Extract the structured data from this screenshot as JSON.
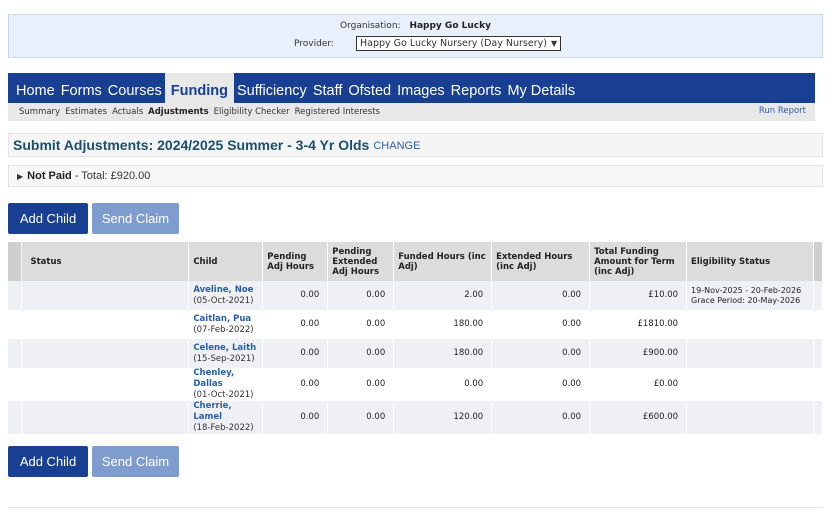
{
  "org": {
    "org_label": "Organisation:",
    "org_name": "Happy Go Lucky",
    "provider_label": "Provider:",
    "provider_value": "Happy Go Lucky Nursery (Day Nursery)"
  },
  "nav": {
    "items": [
      "Home",
      "Forms",
      "Courses",
      "Funding",
      "Sufficiency",
      "Staff",
      "Ofsted",
      "Images",
      "Reports",
      "My Details"
    ],
    "active": "Funding"
  },
  "subnav": {
    "items": [
      "Summary",
      "Estimates",
      "Actuals",
      "Adjustments",
      "Eligibility Checker",
      "Registered Interests"
    ],
    "active": "Adjustments",
    "run_report": "Run Report"
  },
  "page": {
    "title": "Submit Adjustments: 2024/2025 Summer - 3-4 Yr Olds",
    "change_link": "CHANGE",
    "not_paid_label": "Not Paid",
    "not_paid_total": "- Total: £920.00"
  },
  "buttons": {
    "add_child": "Add Child",
    "send_claim": "Send Claim"
  },
  "table": {
    "headers": {
      "status": "Status",
      "child": "Child",
      "pending_adj": "Pending Adj Hours",
      "pending_ext": "Pending Extended Adj Hours",
      "funded": "Funded Hours (inc Adj)",
      "extended": "Extended Hours (inc Adj)",
      "total": "Total Funding Amount for Term (inc Adj)",
      "eligibility": "Eligibility Status"
    },
    "rows": [
      {
        "name": "Aveline, Noe",
        "dob": "(05-Oct-2021)",
        "pending_adj": "0.00",
        "pending_ext": "0.00",
        "funded": "2.00",
        "extended": "0.00",
        "total": "£10.00",
        "elig1": "19-Nov-2025 - 20-Feb-2026",
        "elig2": "Grace Period: 20-May-2026"
      },
      {
        "name": "Caitlan, Pua",
        "dob": "(07-Feb-2022)",
        "pending_adj": "0.00",
        "pending_ext": "0.00",
        "funded": "180.00",
        "extended": "0.00",
        "total": "£1810.00",
        "elig1": "",
        "elig2": ""
      },
      {
        "name": "Celene, Laith",
        "dob": "(15-Sep-2021)",
        "pending_adj": "0.00",
        "pending_ext": "0.00",
        "funded": "180.00",
        "extended": "0.00",
        "total": "£900.00",
        "elig1": "",
        "elig2": ""
      },
      {
        "name": "Chenley, Dallas",
        "dob": "(01-Oct-2021)",
        "pending_adj": "0.00",
        "pending_ext": "0.00",
        "funded": "0.00",
        "extended": "0.00",
        "total": "£0.00",
        "elig1": "",
        "elig2": ""
      },
      {
        "name": "Cherrie, Lamel",
        "dob": "(18-Feb-2022)",
        "pending_adj": "0.00",
        "pending_ext": "0.00",
        "funded": "120.00",
        "extended": "0.00",
        "total": "£600.00",
        "elig1": "",
        "elig2": ""
      }
    ]
  },
  "icons": {
    "expand": "triangle-right-icon",
    "dropdown": "chevron-down-icon"
  }
}
